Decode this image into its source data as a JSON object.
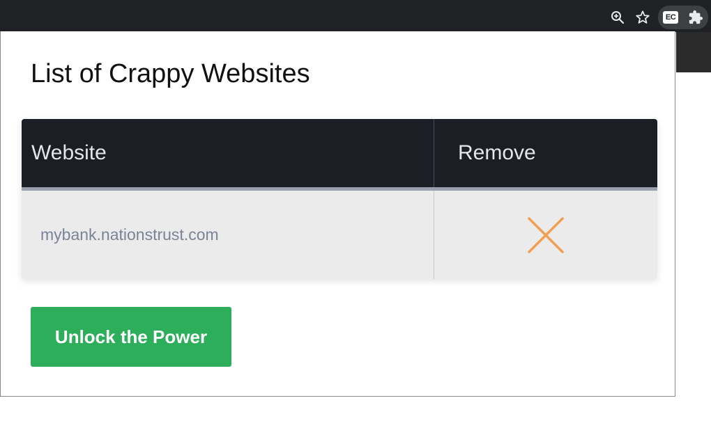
{
  "browser": {
    "icons": [
      "zoom-in-icon",
      "bookmark-star-icon",
      "extension-ec-icon",
      "extensions-puzzle-icon"
    ],
    "extension_badge": "EC"
  },
  "popup": {
    "title": "List of Crappy Websites",
    "table": {
      "columns": [
        "Website",
        "Remove"
      ],
      "rows": [
        {
          "website": "mybank.nationstrust.com",
          "remove_icon": "close-x-icon"
        }
      ]
    },
    "unlock_button": "Unlock the Power"
  },
  "colors": {
    "table_header_bg": "#1c1e25",
    "row_bg": "#ebebeb",
    "remove_icon": "#f0a050",
    "button_bg": "#2cae5a",
    "browser_bar_bg": "#202124"
  }
}
